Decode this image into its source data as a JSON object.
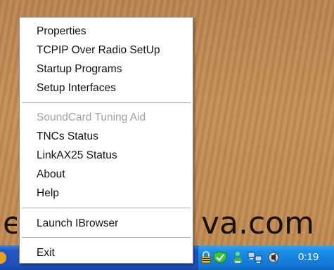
{
  "wallpaper": {
    "text_left": "e",
    "text_right": "va.com"
  },
  "menu": {
    "items": [
      {
        "label": "Properties",
        "enabled": true
      },
      {
        "label": "TCPIP Over Radio SetUp",
        "enabled": true
      },
      {
        "label": "Startup Programs",
        "enabled": true
      },
      {
        "label": "Setup Interfaces",
        "enabled": true
      },
      {
        "label": "SoundCard Tuning Aid",
        "enabled": false
      },
      {
        "label": "TNCs Status",
        "enabled": true
      },
      {
        "label": "LinkAX25 Status",
        "enabled": true
      },
      {
        "label": "About",
        "enabled": true
      },
      {
        "label": "Help",
        "enabled": true
      },
      {
        "label": "Launch IBrowser",
        "enabled": true
      },
      {
        "label": "Exit",
        "enabled": true
      }
    ]
  },
  "taskbar": {
    "tray_icons": [
      "lock-icon",
      "shield-icon",
      "user-icon",
      "network-icon",
      "volume-icon"
    ],
    "clock": "0:19"
  },
  "colors": {
    "menu_background": "#ffffff",
    "disabled_text": "#a3a3a3",
    "taskbar_blue": "#2457c5",
    "tray_blue": "#1a8ee6"
  }
}
